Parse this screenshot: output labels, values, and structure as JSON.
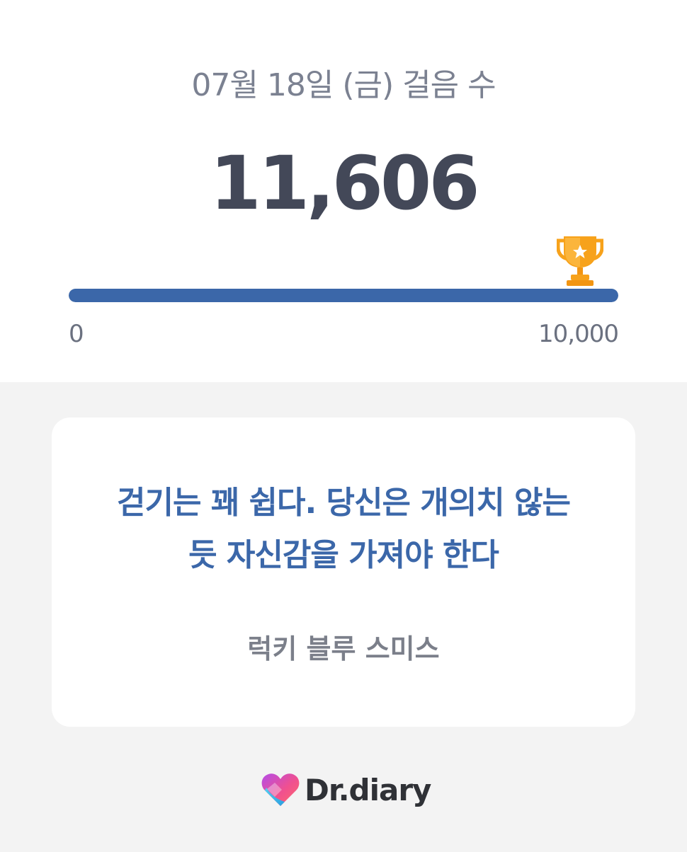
{
  "steps": {
    "date_title": "07월 18일 (금) 걸음 수",
    "count": "11,606",
    "goal_min_label": "0",
    "goal_max_label": "10,000",
    "progress_fraction": 1.0,
    "trophy_icon": "trophy-icon"
  },
  "quote": {
    "text_line1": "걷기는 꽤 쉽다. 당신은 개의치 않는",
    "text_line2": "듯 자신감을 가져야 한다",
    "author": "럭키 블루 스미스"
  },
  "brand": {
    "name": "Dr.diary",
    "logo_icon": "heart-logo-icon"
  },
  "colors": {
    "accent": "#3b67a9",
    "count_text": "#434858",
    "muted_text": "#7b8191",
    "trophy": "#f5a623"
  }
}
